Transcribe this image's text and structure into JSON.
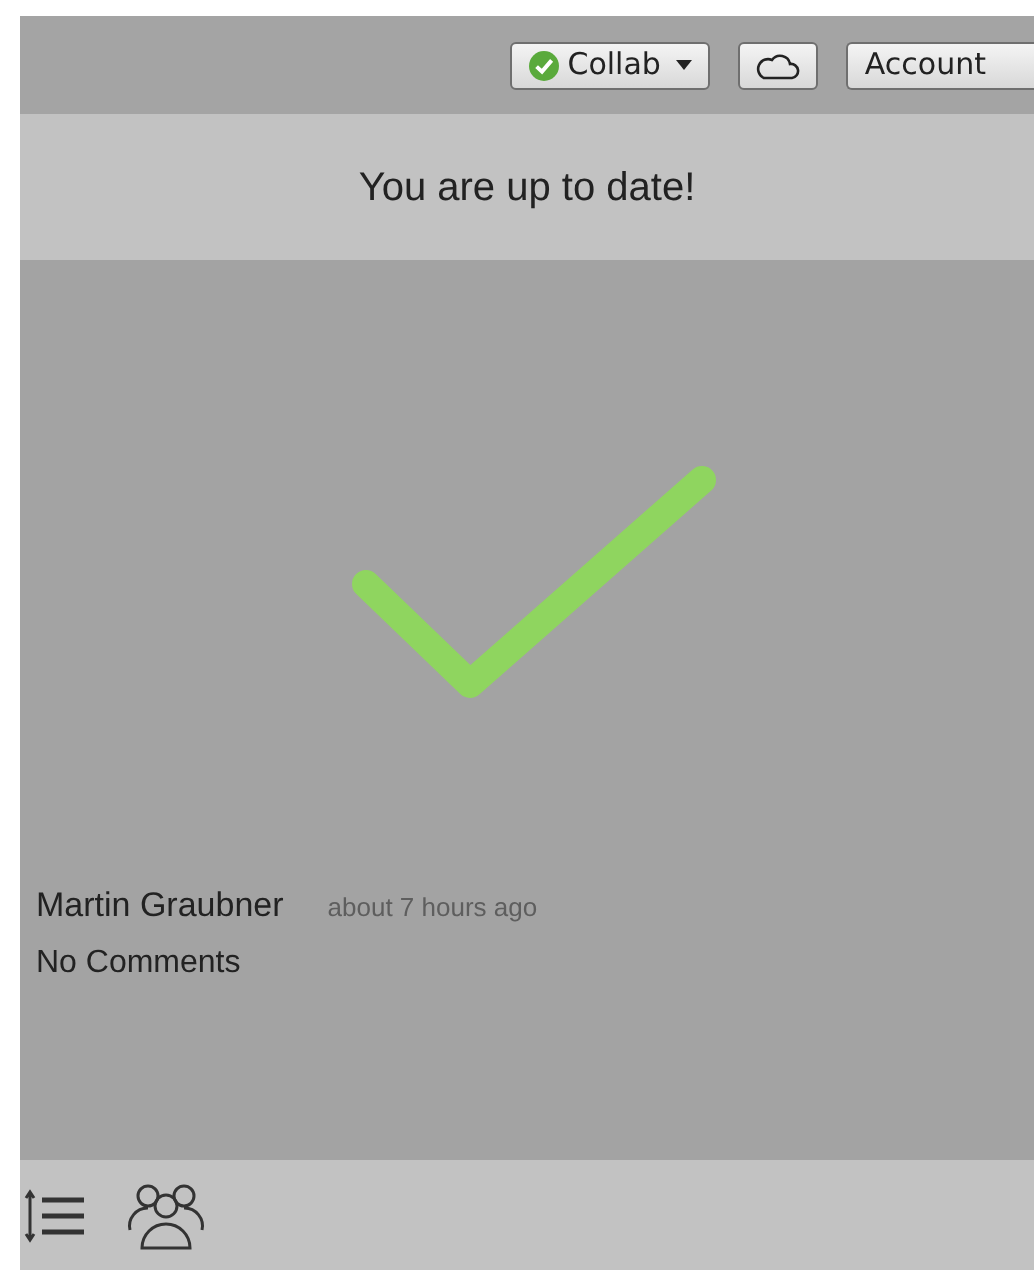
{
  "toolbar": {
    "collab": {
      "label": "Collab",
      "synced": true
    },
    "account": {
      "label": "Account"
    }
  },
  "status_message": "You are up to date!",
  "revision": {
    "author": "Martin Graubner",
    "time": "about 7 hours ago",
    "comments": "No Comments"
  }
}
